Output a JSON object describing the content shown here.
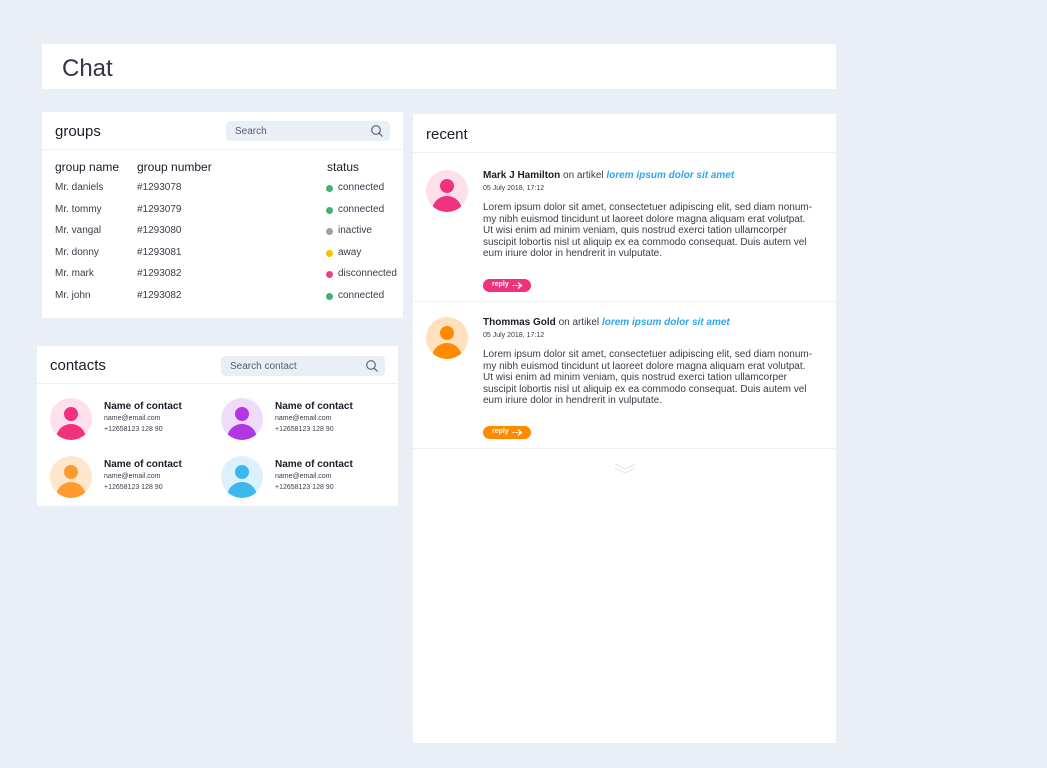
{
  "header": {
    "title": "Chat"
  },
  "groups": {
    "title": "groups",
    "search_placeholder": "Search",
    "columns": {
      "name": "group name",
      "number": "group  number",
      "status": "status"
    },
    "rows": [
      {
        "name": "Mr. daniels",
        "number": "#1293078",
        "status": "connected",
        "status_color": "#3cb371"
      },
      {
        "name": "Mr. tommy",
        "number": "#1293079",
        "status": "connected",
        "status_color": "#3cb371"
      },
      {
        "name": "Mr. vangal",
        "number": "#1293080",
        "status": "inactive",
        "status_color": "#a0a0a0"
      },
      {
        "name": "Mr. donny",
        "number": "#1293081",
        "status": "away",
        "status_color": "#f5c000"
      },
      {
        "name": "Mr. mark",
        "number": "#1293082",
        "status": "disconnected",
        "status_color": "#ee3d8f"
      },
      {
        "name": "Mr. john",
        "number": "#1293082",
        "status": "connected",
        "status_color": "#3cb371"
      }
    ]
  },
  "contacts": {
    "title": "contacts",
    "search_placeholder": "Search contact",
    "items": [
      {
        "name": "Name of contact",
        "email": "name@email.com",
        "phone": "+12658123 128 90",
        "avatar_color": "#f0317e",
        "avatar_bg": "#fde0ec"
      },
      {
        "name": "Name of contact",
        "email": "name@email.com",
        "phone": "+12658123 128 90",
        "avatar_color": "#b336e0",
        "avatar_bg": "#efdcfa"
      },
      {
        "name": "Name of contact",
        "email": "name@email.com",
        "phone": "+12658123 128 90",
        "avatar_color": "#ff9a2e",
        "avatar_bg": "#ffe6cc"
      },
      {
        "name": "Name of contact",
        "email": "name@email.com",
        "phone": "+12658123 128 90",
        "avatar_color": "#3db8ee",
        "avatar_bg": "#dcf1fc"
      }
    ]
  },
  "recent": {
    "title": "recent",
    "posts": [
      {
        "author": "Mark J Hamilton",
        "on_text": " on artikel ",
        "link": "lorem ipsum dolor sit amet",
        "date": "05 July 2018, 17:12",
        "body": "Lorem ipsum dolor sit amet, consectetuer adipiscing elit, sed diam nonum-my nibh euismod tincidunt ut laoreet dolore magna aliquam erat volutpat. Ut wisi enim ad minim veniam, quis nostrud exerci tation ullamcorper suscipit lobortis nisl ut aliquip ex ea commodo consequat. Duis autem vel eum iriure dolor in hendrerit in vulputate.",
        "reply_label": "reply",
        "avatar_color": "#f0317e",
        "avatar_bg": "#fde0ec",
        "reply_color": "#f0317e"
      },
      {
        "author": "Thommas Gold",
        "on_text": " on artikel ",
        "link": "lorem ipsum dolor sit amet",
        "date": "05 July 2018, 17:12",
        "body": "Lorem ipsum dolor sit amet, consectetuer adipiscing elit, sed diam nonum-my nibh euismod tincidunt ut laoreet dolore magna aliquam erat volutpat. Ut wisi enim ad minim veniam, quis nostrud exerci tation ullamcorper suscipit lobortis nisl ut aliquip ex ea commodo consequat. Duis autem vel eum iriure dolor in hendrerit in vulputate.",
        "reply_label": "reply",
        "avatar_color": "#ff8a00",
        "avatar_bg": "#ffe0bd",
        "reply_color": "#ff8a00"
      }
    ]
  },
  "icons": {
    "search": "search-icon",
    "reply_arrow": "arrow-right-icon",
    "more": "double-chevron-down-icon"
  }
}
